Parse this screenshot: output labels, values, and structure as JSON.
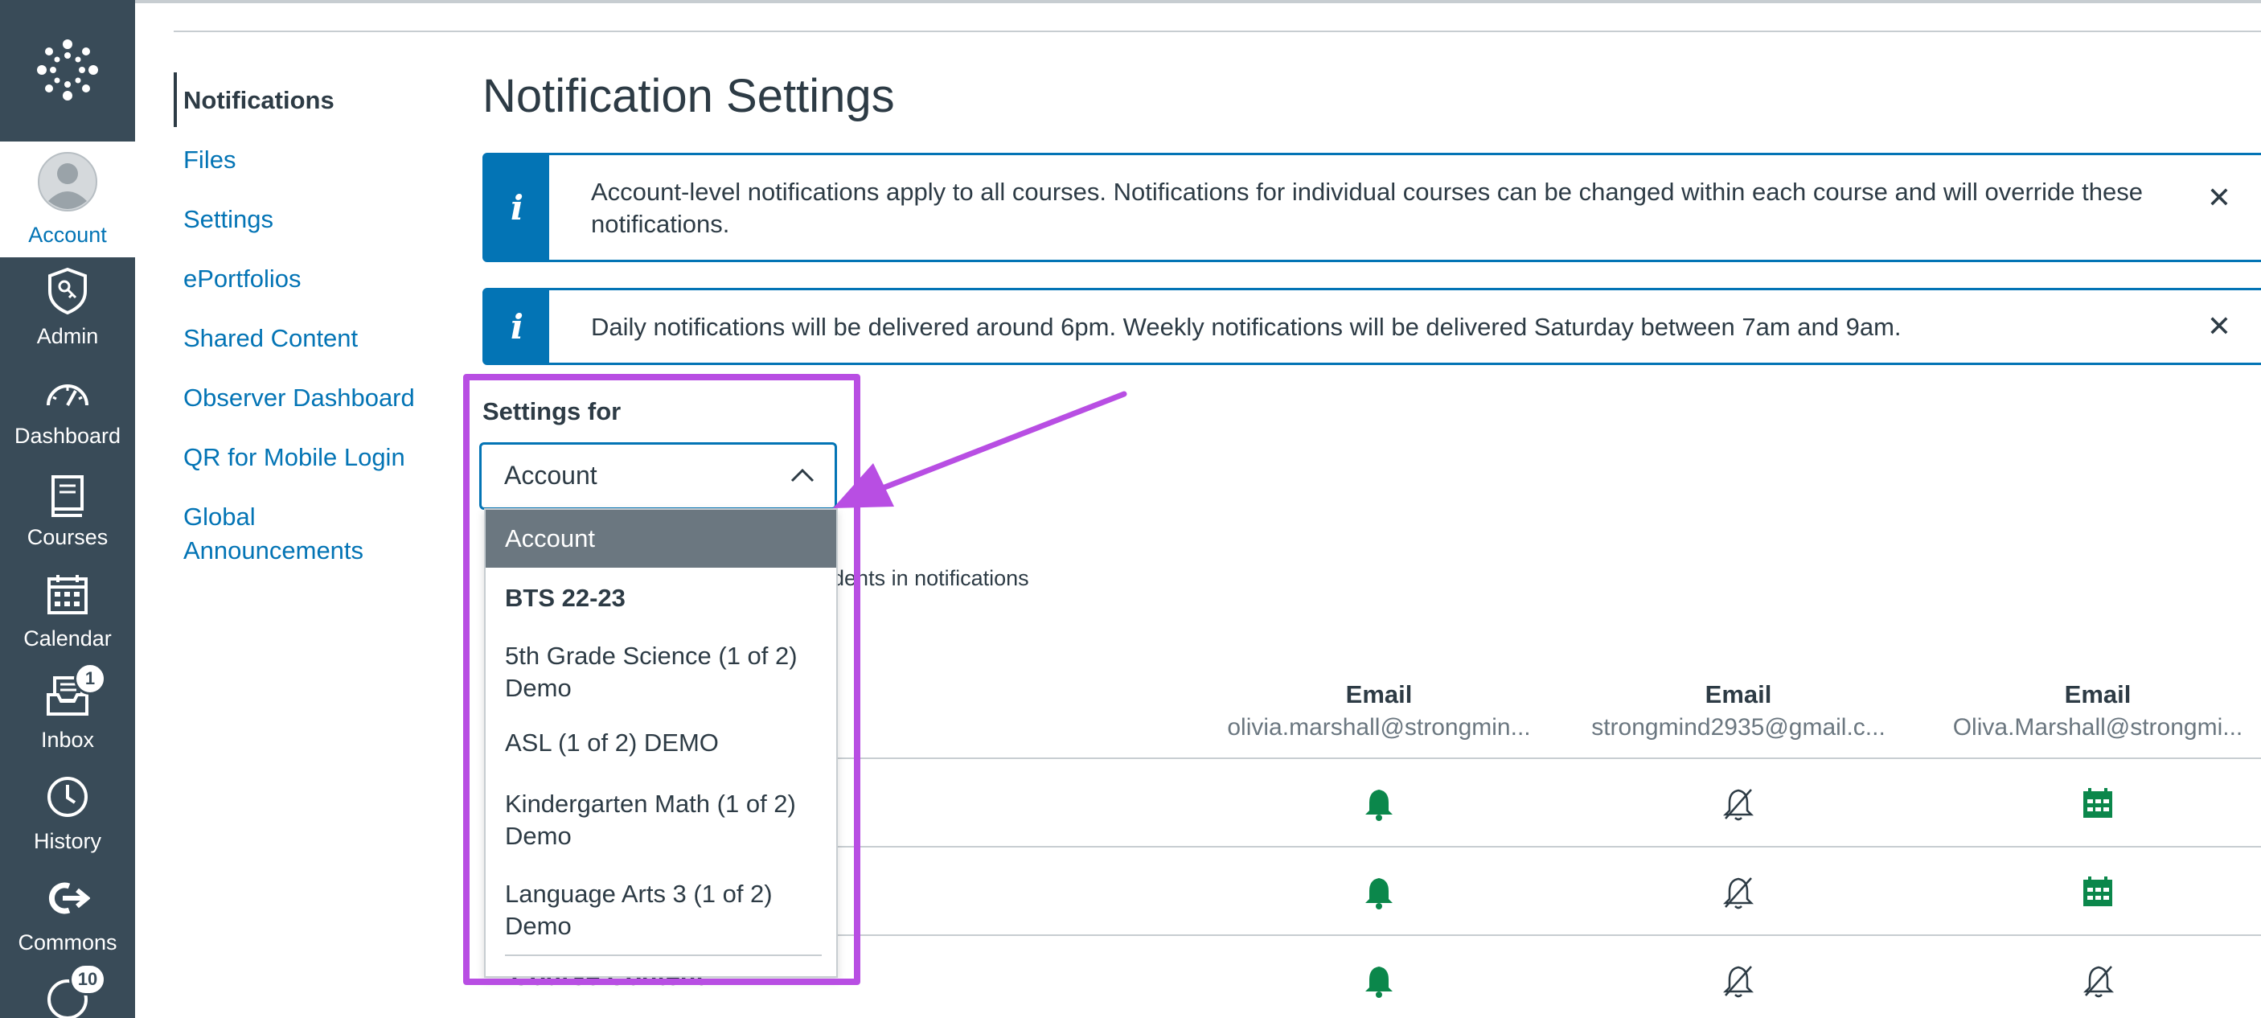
{
  "global_nav": {
    "items": [
      {
        "label": "Account",
        "icon": "avatar-icon",
        "active": true
      },
      {
        "label": "Admin",
        "icon": "admin-shield-icon"
      },
      {
        "label": "Dashboard",
        "icon": "dashboard-icon"
      },
      {
        "label": "Courses",
        "icon": "courses-book-icon"
      },
      {
        "label": "Calendar",
        "icon": "calendar-icon"
      },
      {
        "label": "Inbox",
        "icon": "inbox-icon",
        "badge": "1"
      },
      {
        "label": "History",
        "icon": "history-clock-icon"
      },
      {
        "label": "Commons",
        "icon": "commons-icon"
      },
      {
        "label": "",
        "icon": "help-icon",
        "badge": "10"
      }
    ]
  },
  "section_nav": {
    "items": [
      {
        "label": "Notifications",
        "active": true
      },
      {
        "label": "Files"
      },
      {
        "label": "Settings"
      },
      {
        "label": "ePortfolios"
      },
      {
        "label": "Shared Content"
      },
      {
        "label": "Observer Dashboard"
      },
      {
        "label": "QR for Mobile Login"
      },
      {
        "label": "Global",
        "label2": "Announcements"
      }
    ]
  },
  "page": {
    "title": "Notification Settings",
    "alerts": [
      {
        "text": "Account-level notifications apply to all courses. Notifications for individual courses can be changed within each course and will override these notifications."
      },
      {
        "text": "Daily notifications will be delivered around 6pm. Weekly notifications will be delivered Saturday between 7am and 9am."
      }
    ],
    "settings_for_label": "Settings for",
    "select_value": "Account",
    "dropdown_options": [
      {
        "label": "Account",
        "selected": true
      },
      {
        "label": "BTS 22-23",
        "group": true
      },
      {
        "label": "5th Grade Science (1 of 2)",
        "label2": "Demo"
      },
      {
        "label": "ASL (1 of 2) DEMO"
      },
      {
        "label": "Kindergarten Math (1 of 2)",
        "label2": "Demo"
      },
      {
        "label": "Language Arts 3 (1 of 2)",
        "label2": "Demo"
      }
    ],
    "behind_text": "udents in notifications",
    "row3_label": "Course Content",
    "columns": [
      {
        "type": "Email",
        "address": "olivia.marshall@strongmin..."
      },
      {
        "type": "Email",
        "address": "strongmind2935@gmail.c..."
      },
      {
        "type": "Email",
        "address": "Oliva.Marshall@strongmi..."
      }
    ],
    "rows": [
      [
        "bell-icon",
        "bell-off-icon",
        "calendar-weekly-icon"
      ],
      [
        "bell-icon",
        "bell-off-icon",
        "calendar-weekly-icon"
      ],
      [
        "bell-icon",
        "bell-off-icon",
        "bell-off-icon"
      ]
    ]
  },
  "colors": {
    "nav_bg": "#394b58",
    "link": "#0374b5",
    "highlight": "#b84ee3",
    "on_green": "#0b874b"
  }
}
